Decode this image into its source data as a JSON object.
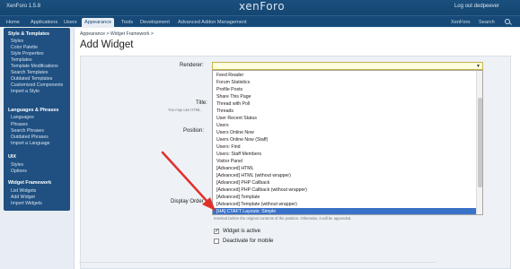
{
  "header": {
    "version": "XenForo 1.5.8",
    "logo": "xenForo",
    "logout": "Log out dedpeever"
  },
  "nav": {
    "tabs": [
      "Home",
      "Applications",
      "Users",
      "Appearance",
      "Tools",
      "Development",
      "Advanced Addon Management"
    ],
    "right_label": "XenForo",
    "search_label": "Search"
  },
  "sidebar": {
    "groups": [
      {
        "title": "Style & Templates",
        "items": [
          "Styles",
          "Color Palette",
          "Style Properties",
          "Templates",
          "Template Modifications",
          "Search Templates",
          "Outdated Templates",
          "Customized Components",
          "Import a Style"
        ]
      },
      {
        "title": "Languages & Phrases",
        "items": [
          "Languages",
          "Phrases",
          "Search Phrases",
          "Outdated Phrases",
          "Import a Language"
        ]
      },
      {
        "title": "UIX",
        "items": [
          "Styles",
          "Options"
        ]
      },
      {
        "title": "Widget Framework",
        "items": [
          "List Widgets",
          "Add Widget",
          "Import Widgets"
        ]
      }
    ]
  },
  "main": {
    "breadcrumb": "Appearance >   Widget Framework >",
    "title": "Add Widget"
  },
  "form": {
    "renderer_label": "Renderer:",
    "title_label": "Title:",
    "title_hint": "You may use HTML",
    "position_label": "Position:",
    "display_order_label": "Display Order",
    "insert_hint": "Inserted before the original contents of the position. Otherwise, it will be appended.",
    "widget_active_label": "Widget is active",
    "widget_active_checked": true,
    "deactivate_mobile_label": "Deactivate for mobile",
    "deactivate_mobile_checked": false
  },
  "dropdown": {
    "options": [
      "Feed Reader",
      "Forum Statistics",
      "Profile Posts",
      "Share This Page",
      "Thread with Poll",
      "Threads",
      "User Recent Status",
      "Users",
      "Users Online Now",
      "Users Online Now (Staff)",
      "Users: Find",
      "Users: Staff Members",
      "Visitor Panel",
      "[Advanced] HTML",
      "[Advanced] HTML (without wrapper)",
      "[Advanced] PHP Callback",
      "[Advanced] PHP Callback (without wrapper)",
      "[Advanced] Template",
      "[Advanced] Template (without wrapper)",
      "[HA] CTAFT Layouts: Simple"
    ],
    "selected_index": 19
  },
  "colors": {
    "header_bg": "#174a78",
    "sidebar_bg": "#1f5081",
    "selected_option": "#3a72c8",
    "arrow": "#e0302a"
  }
}
